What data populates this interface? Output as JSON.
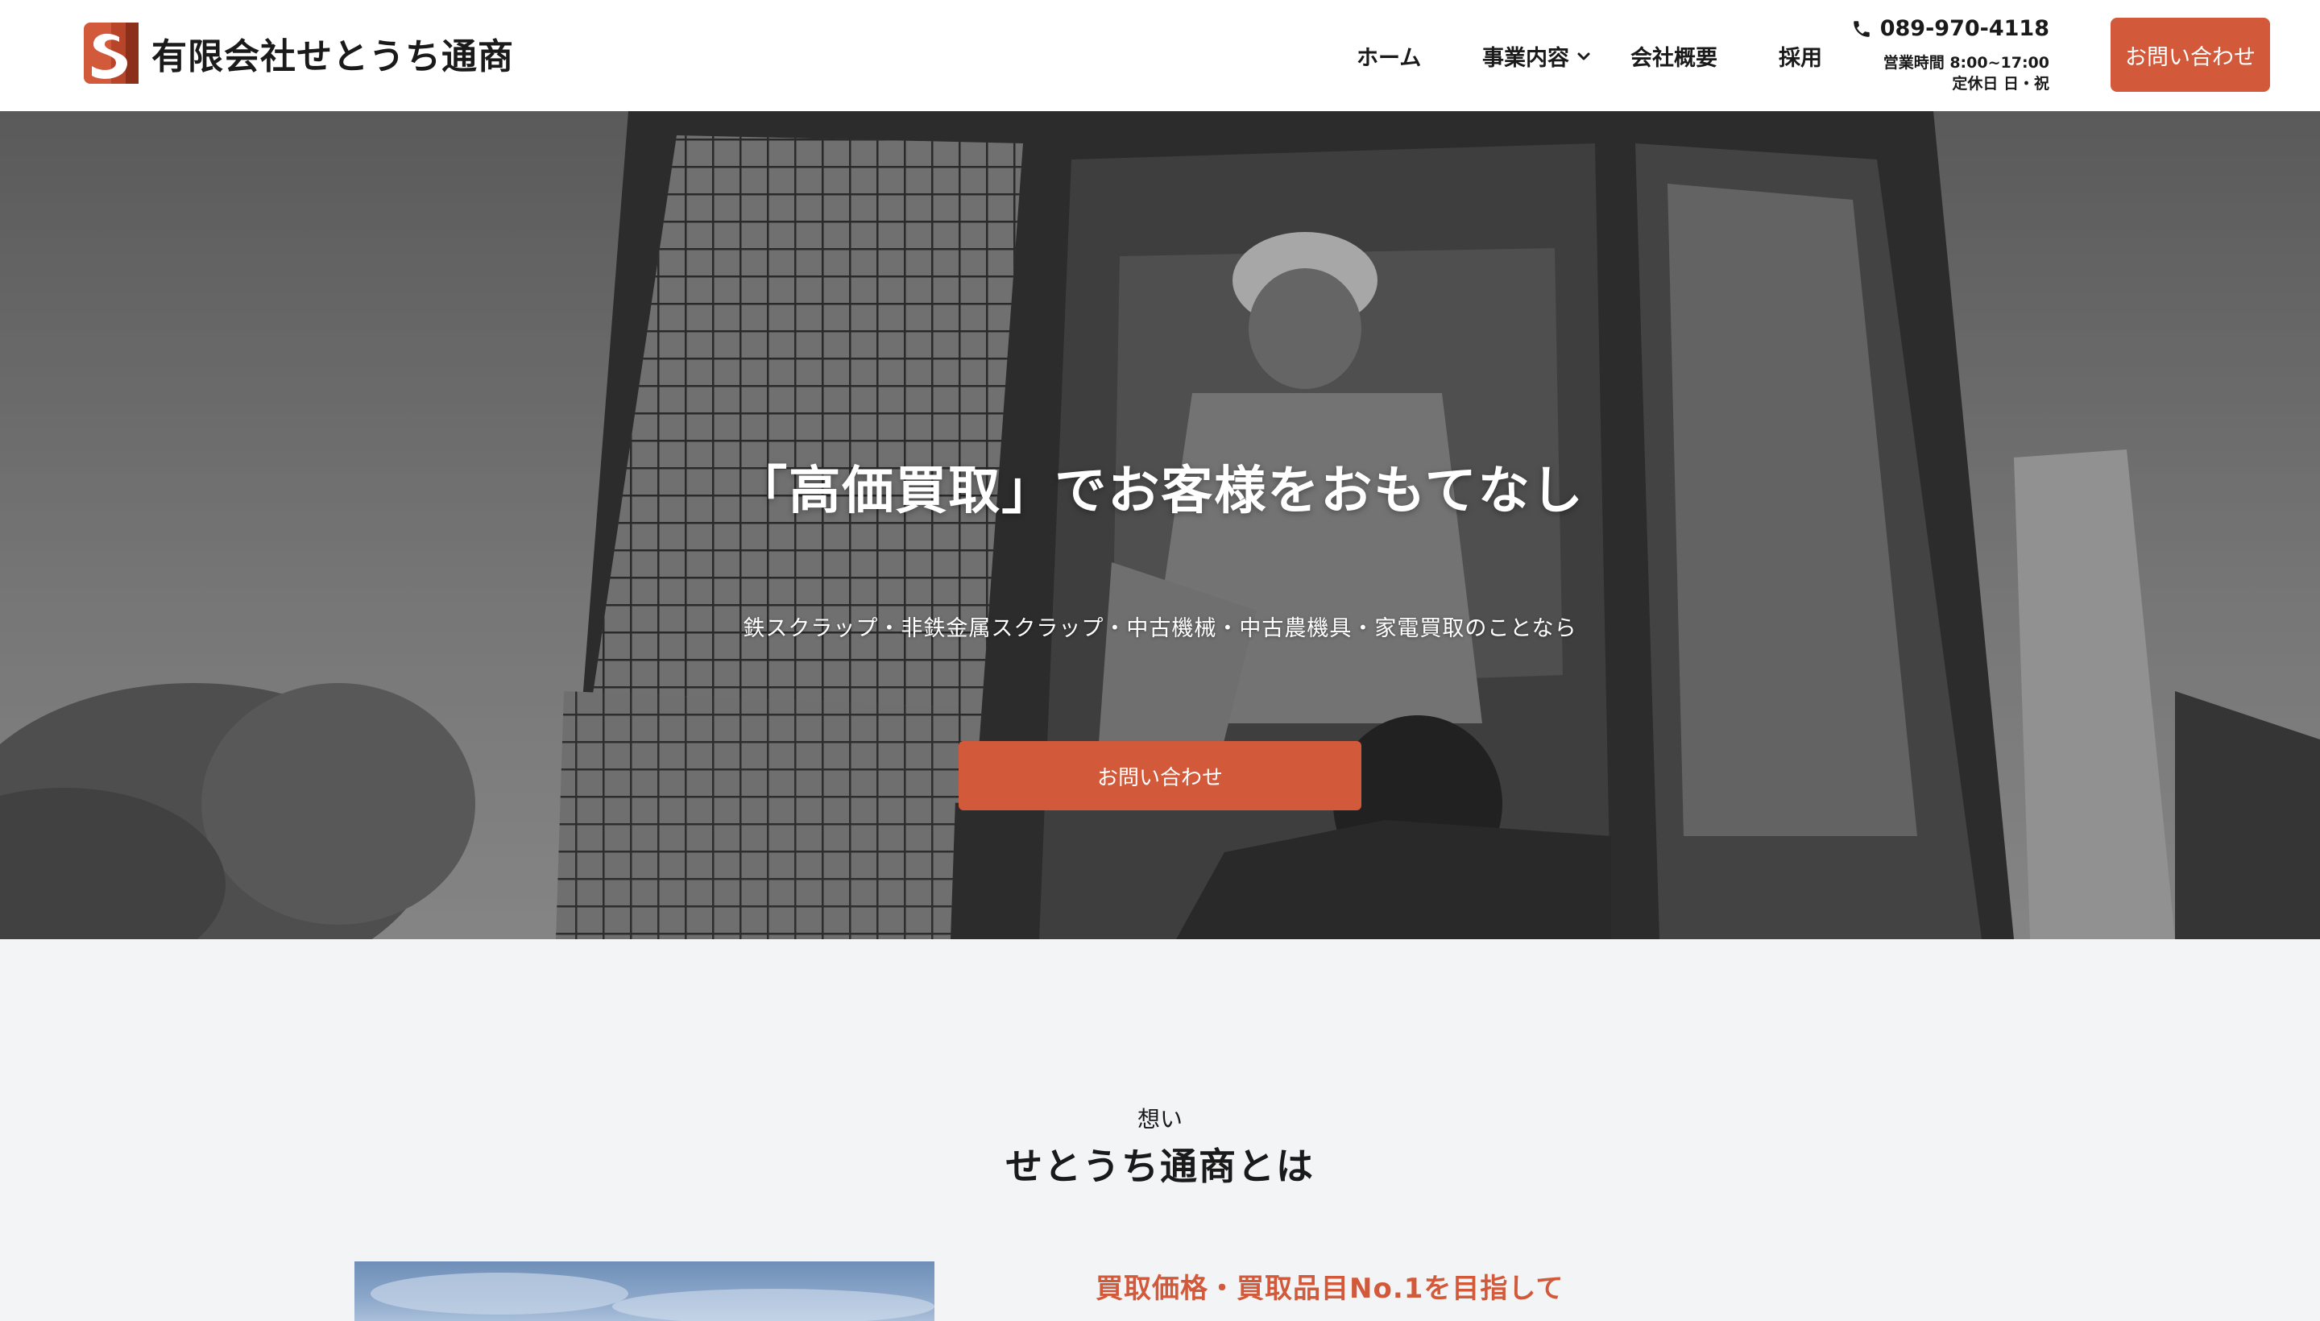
{
  "brand": {
    "name": "有限会社せとうち通商",
    "accent": "#d2593a"
  },
  "nav": {
    "home": "ホーム",
    "services": "事業内容",
    "company": "会社概要",
    "recruit": "採用"
  },
  "contact": {
    "phone": "089-970-4118",
    "hours": "営業時間 8:00~17:00",
    "closed": "定休日 日・祝",
    "cta_label": "お問い合わせ"
  },
  "hero": {
    "title": "「高価買取」でお客様をおもてなし",
    "subtitle": "鉄スクラップ・非鉄金属スクラップ・中古機械・中古農機具・家電買取のことなら",
    "cta_label": "お問い合わせ"
  },
  "about": {
    "eyebrow": "想い",
    "title": "せとうち通商とは",
    "heading": "買取価格・買取品目No.1を目指して"
  },
  "icons": {
    "logo": "logo-mark-icon",
    "dropdown": "chevron-down-icon",
    "phone": "phone-icon"
  }
}
